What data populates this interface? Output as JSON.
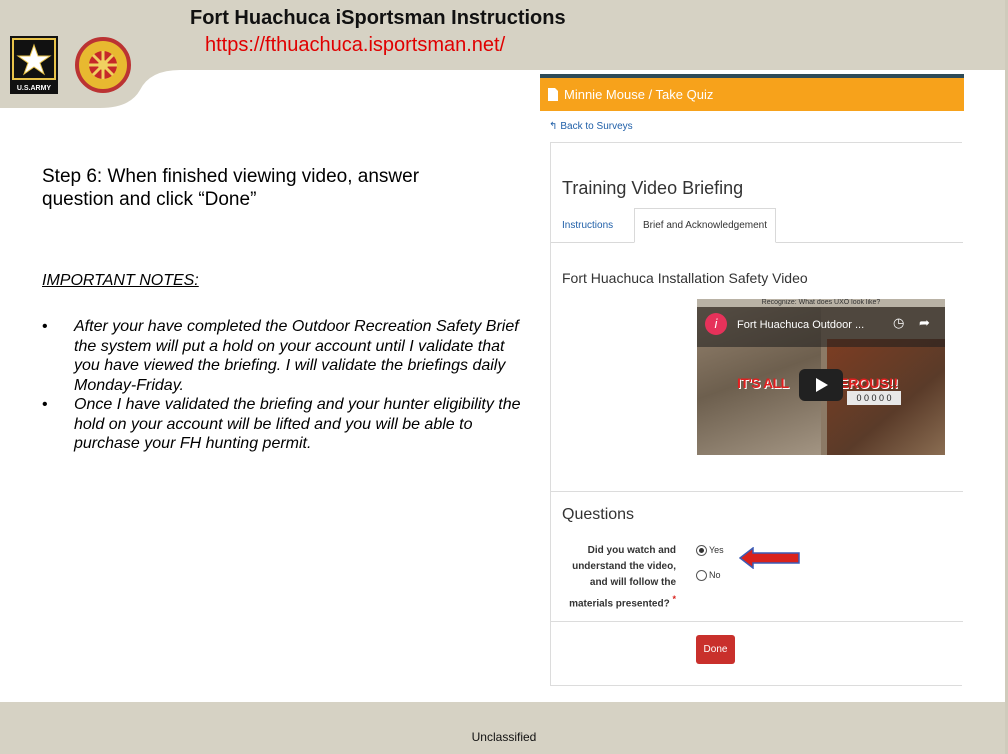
{
  "slide": {
    "title": "Fort Huachuca iSportsman Instructions",
    "url": "https://fthuachuca.isportsman.net/",
    "army_logo_text": "U.S.ARMY",
    "step_text": "Step 6: When finished viewing video, answer question and click “Done”",
    "notes_title": "IMPORTANT NOTES:",
    "notes": [
      "After your have completed the Outdoor Recreation Safety Brief the system will put a hold on your account until I validate that you have viewed the briefing. I will validate the briefings daily Monday-Friday.",
      "Once I have validated the briefing and your hunter eligibility the hold on your account will be lifted and you will be able to purchase your FH hunting permit."
    ],
    "footer": "Unclassified"
  },
  "app": {
    "breadcrumb": "Minnie Mouse / Take Quiz",
    "back_link": "Back to Surveys",
    "title": "Training Video Briefing",
    "tabs": [
      "Instructions",
      "Brief and Acknowledgement"
    ],
    "video_heading": "Fort Huachuca Installation Safety Video",
    "video": {
      "caption": "Recognize: What does UXO look like?",
      "avatar_letter": "i",
      "channel_title": "Fort Huachuca Outdoor ...",
      "overlay_left": "IT'S ALL",
      "overlay_right": "EROUS!!",
      "numbers": "0 0 0 0 0"
    },
    "questions_heading": "Questions",
    "question": "Did you watch and understand the video, and will follow the materials presented?",
    "required_mark": "*",
    "options": [
      "Yes",
      "No"
    ],
    "selected_option": "Yes",
    "done_label": "Done"
  },
  "colors": {
    "header_orange": "#f7a21b",
    "url_red": "#e00000",
    "done_red": "#c9302c",
    "banner_tan": "#d6d2c4",
    "link_blue": "#1f5fa8"
  }
}
